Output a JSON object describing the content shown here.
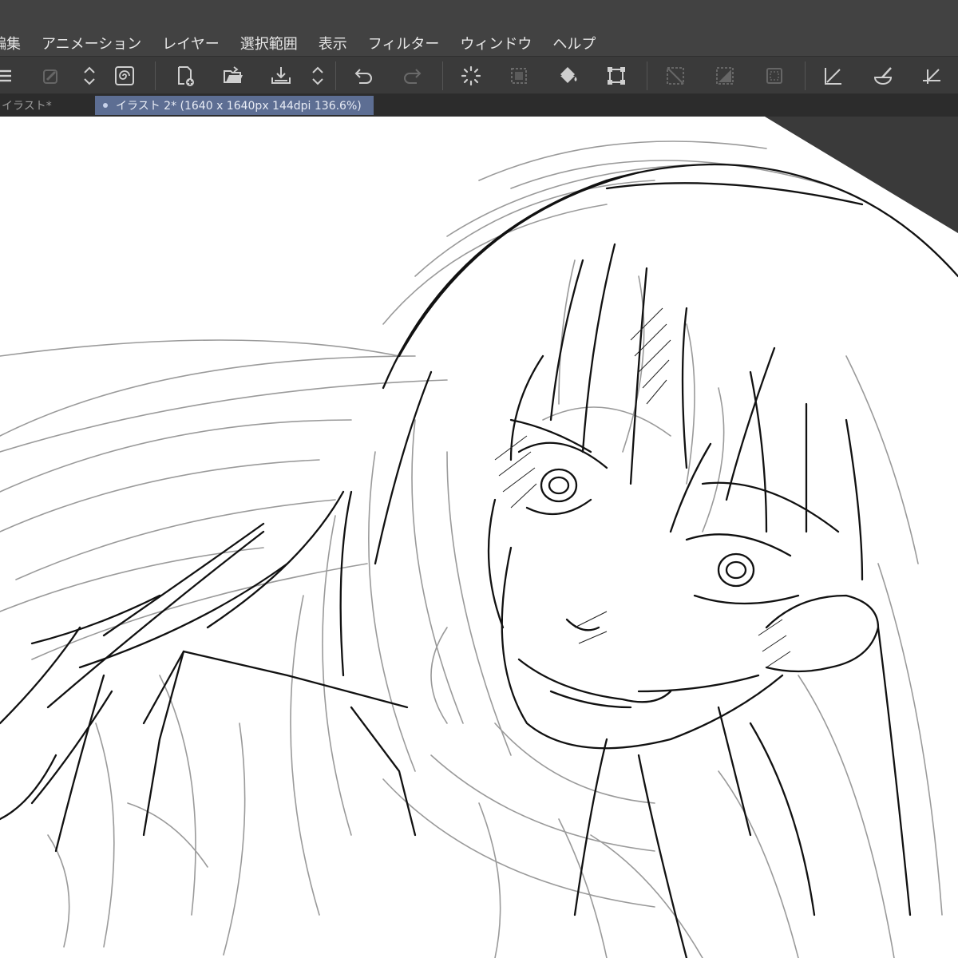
{
  "menu": [
    "編集",
    "アニメーション",
    "レイヤー",
    "選択範囲",
    "表示",
    "フィルター",
    "ウィンドウ",
    "ヘルプ"
  ],
  "tabs": [
    {
      "label": "イラスト*",
      "active": false
    },
    {
      "label": "イラスト 2* (1640 x 1640px 144dpi 136.6%)",
      "active": true
    }
  ],
  "toolbar_icons": [
    "menu-icon",
    "layer-color-icon",
    "up-down-icon",
    "spiral-icon",
    "new-file-icon",
    "open-folder-icon",
    "save-icon",
    "up-down-icon",
    "undo-icon",
    "redo-icon",
    "loading-icon",
    "selection-icon",
    "fill-icon",
    "transform-icon",
    "hide-selection-icon",
    "fill-selection-icon",
    "clear-selection-icon",
    "ruler-icon",
    "brush-icon",
    "perspective-ruler-icon"
  ],
  "colors": {
    "chrome": "#424242",
    "toolbar": "#3a3a3a",
    "tabbar": "#2c2c2c",
    "active_tab": "#5d6e93",
    "canvas": "#ffffff"
  }
}
